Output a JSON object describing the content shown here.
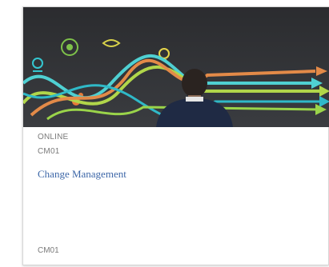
{
  "card": {
    "delivery": "ONLINE",
    "code": "CM01",
    "title": "Change Management",
    "footer_code": "CM01",
    "image_icon": "chalkboard-arrows-man-illustration",
    "colors": {
      "title_link": "#3d67a8",
      "meta_text": "#7a7a7a",
      "chalkboard": "#2f3134"
    }
  }
}
